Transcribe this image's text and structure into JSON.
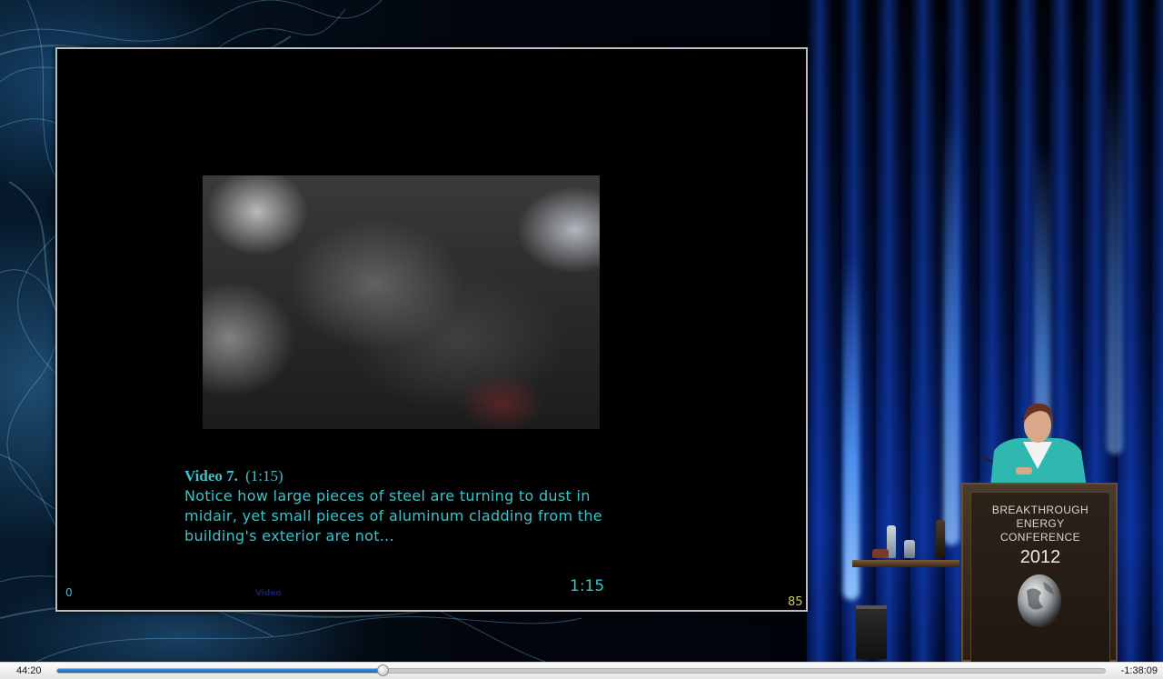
{
  "slide": {
    "video_label": "Video 7.",
    "video_duration": "(1:15)",
    "caption_lines": [
      "Notice how large pieces of steel are turning to dust in",
      "midair, yet small pieces of aluminum cladding from the",
      "building's exterior are not..."
    ],
    "timer": "1:15",
    "counter_left": "0",
    "page_number": "85",
    "faint_label": "Video"
  },
  "podium": {
    "title_lines": [
      "BREAKTHROUGH",
      "ENERGY",
      "CONFERENCE"
    ],
    "year": "2012"
  },
  "player": {
    "elapsed": "44:20",
    "remaining": "-1:38:09",
    "progress_fraction": 0.311
  },
  "colors": {
    "caption": "#3ec1c8",
    "page_number": "#c8c860",
    "seek_fill": "#2a78d0"
  }
}
